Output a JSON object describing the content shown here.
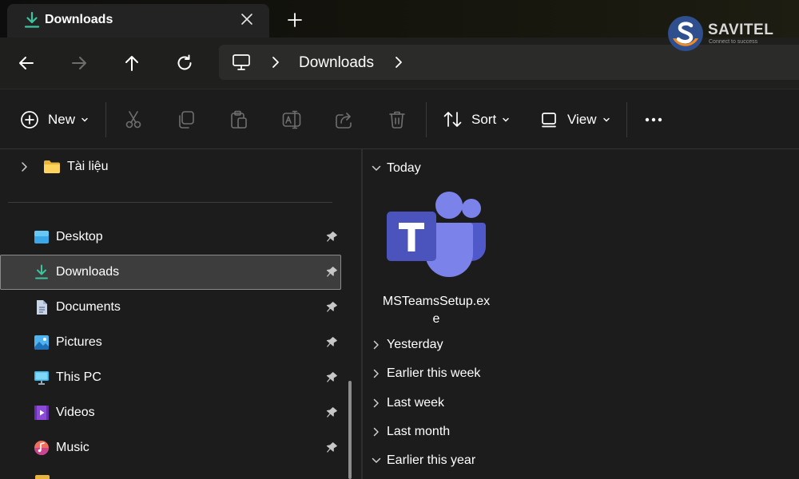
{
  "window": {
    "tab_title": "Downloads",
    "tab_icon": "download-icon",
    "new_tab_icon": "plus-icon",
    "close_tab_icon": "close-icon"
  },
  "logo": {
    "name": "SAVITEL",
    "tagline": "Connect to success"
  },
  "address_bar": {
    "location_icon": "this-pc-icon",
    "crumbs": [
      "Downloads"
    ]
  },
  "navigation": {
    "back_icon": "arrow-left-icon",
    "forward_icon": "arrow-right-icon",
    "up_icon": "arrow-up-icon",
    "refresh_icon": "refresh-icon"
  },
  "command_bar": {
    "new_label": "New",
    "sort_label": "Sort",
    "view_label": "View",
    "icons": [
      "new-icon",
      "cut-icon",
      "copy-icon",
      "paste-icon",
      "rename-icon",
      "share-icon",
      "delete-icon",
      "sort-icon",
      "view-icon",
      "more-icon"
    ]
  },
  "sidebar": {
    "folder_item": {
      "label": "Tài liệu",
      "icon": "folder-icon"
    },
    "quick_access": [
      {
        "label": "Desktop",
        "icon": "desktop-icon",
        "pinned": true
      },
      {
        "label": "Downloads",
        "icon": "download-icon",
        "pinned": true,
        "selected": true
      },
      {
        "label": "Documents",
        "icon": "documents-icon",
        "pinned": true
      },
      {
        "label": "Pictures",
        "icon": "pictures-icon",
        "pinned": true
      },
      {
        "label": "This PC",
        "icon": "this-pc-icon",
        "pinned": true
      },
      {
        "label": "Videos",
        "icon": "videos-icon",
        "pinned": true
      },
      {
        "label": "Music",
        "icon": "music-icon",
        "pinned": true
      }
    ]
  },
  "content": {
    "groups": [
      {
        "label": "Today",
        "expanded": true
      },
      {
        "label": "Yesterday",
        "expanded": false
      },
      {
        "label": "Earlier this week",
        "expanded": false
      },
      {
        "label": "Last week",
        "expanded": false
      },
      {
        "label": "Last month",
        "expanded": false
      },
      {
        "label": "Earlier this year",
        "expanded": true
      }
    ],
    "files": [
      {
        "name": "MSTeamsSetup.exe",
        "icon": "teams-icon"
      }
    ]
  },
  "colors": {
    "accent_download": "#3cc3a0",
    "teams_purple": "#5b5fc7",
    "background": "#1c1c1c"
  }
}
